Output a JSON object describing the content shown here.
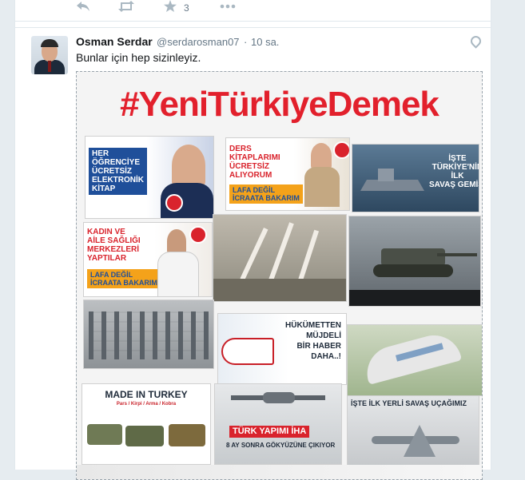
{
  "previous_tweet": {
    "actions": {
      "reply_icon": "reply-icon",
      "retweet_icon": "retweet-icon",
      "like_icon": "star-icon",
      "like_count": "3",
      "more_icon": "more-icon"
    }
  },
  "tweet": {
    "author_name": "Osman Serdar",
    "author_handle": "@serdarosman07",
    "separator": "·",
    "time": "10 sa.",
    "text": "Bunlar için hep sizinleyiz.",
    "location_icon": "location-pin-icon",
    "media": {
      "hashtag": "#YeniTürkiyeDemek",
      "tiles": {
        "t1": {
          "label": "HER\nÖĞRENCİYE\nÜCRETSİZ\nELEKTRONİK\nKİTAP"
        },
        "t2": {
          "label": "DERS\nKİTAPLARIMI\nÜCRETSİZ\nALIYORUM",
          "tag": "LAFA DEĞİL\nİCRAATA BAKARIM"
        },
        "t3": {
          "label": "İŞTE\nTÜRKİYE'NİN\nİLK\nSAVAŞ GEMİSİ"
        },
        "t4": {
          "label": "KADIN VE\nAİLE SAĞLIĞI\nMERKEZLERİ\nYAPTILAR",
          "tag": "LAFA DEĞİL\nİCRAATA BAKARIM"
        },
        "t8": {
          "label": "HÜKÜMETTEN\nMÜJDELİ\nBİR HABER\nDAHA..!"
        },
        "t10": {
          "label": "MADE IN TURKEY",
          "sub": "Pars / Kirpi / Arma / Kobra"
        },
        "t11": {
          "label": "TÜRK YAPIMI İHA",
          "sub": "8 AY SONRA GÖKYÜZÜNE ÇIKIYOR"
        },
        "t12": {
          "label": "İŞTE İLK YERLİ SAVAŞ UÇAĞIMIZ"
        }
      }
    }
  },
  "colors": {
    "red": "#e2202c",
    "blue": "#1f4f9a",
    "orange": "#f4a21a",
    "text": "#14171a",
    "muted": "#657786"
  }
}
